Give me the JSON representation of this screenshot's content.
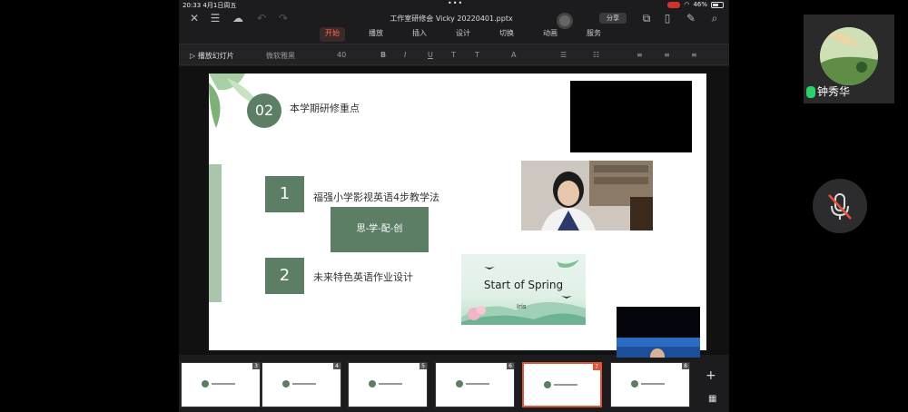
{
  "statusbar": {
    "time": "20:33",
    "date": "4月1日周五",
    "dots": "•••",
    "battery": "46%"
  },
  "titlebar": {
    "doc_title": "工作室研修会 Vicky 20220401.pptx",
    "share_label": "分享"
  },
  "tabs": [
    {
      "label": "开始",
      "active": true
    },
    {
      "label": "播放",
      "active": false
    },
    {
      "label": "插入",
      "active": false
    },
    {
      "label": "设计",
      "active": false
    },
    {
      "label": "切换",
      "active": false
    },
    {
      "label": "动画",
      "active": false
    },
    {
      "label": "服务",
      "active": false
    }
  ],
  "toolbar": {
    "slideshow_label": "播放幻灯片",
    "font_name": "微软雅黑",
    "font_size": "40",
    "bold": "B",
    "italic": "I",
    "underline": "U",
    "strike": "T",
    "shadow": "T",
    "font_color": "A"
  },
  "slide": {
    "section_number": "02",
    "section_title": "本学期研修重点",
    "item1_number": "1",
    "item1_text": "福强小学影视英语4步教学法",
    "sub_box": "思-学-配-创",
    "item2_number": "2",
    "item2_text": "未来特色英语作业设计",
    "card_title": "Start of Spring",
    "card_subtitle": "Iris"
  },
  "thumbnails": [
    {
      "num": "3",
      "active": false
    },
    {
      "num": "4",
      "active": false
    },
    {
      "num": "5",
      "active": false
    },
    {
      "num": "6",
      "active": false
    },
    {
      "num": "7",
      "active": true
    },
    {
      "num": "8",
      "active": false
    }
  ],
  "participant": {
    "name": "钟秀华"
  },
  "colors": {
    "accent": "#e4533b",
    "slide_green": "#5b7e64",
    "mic_green": "#2bd16a"
  }
}
